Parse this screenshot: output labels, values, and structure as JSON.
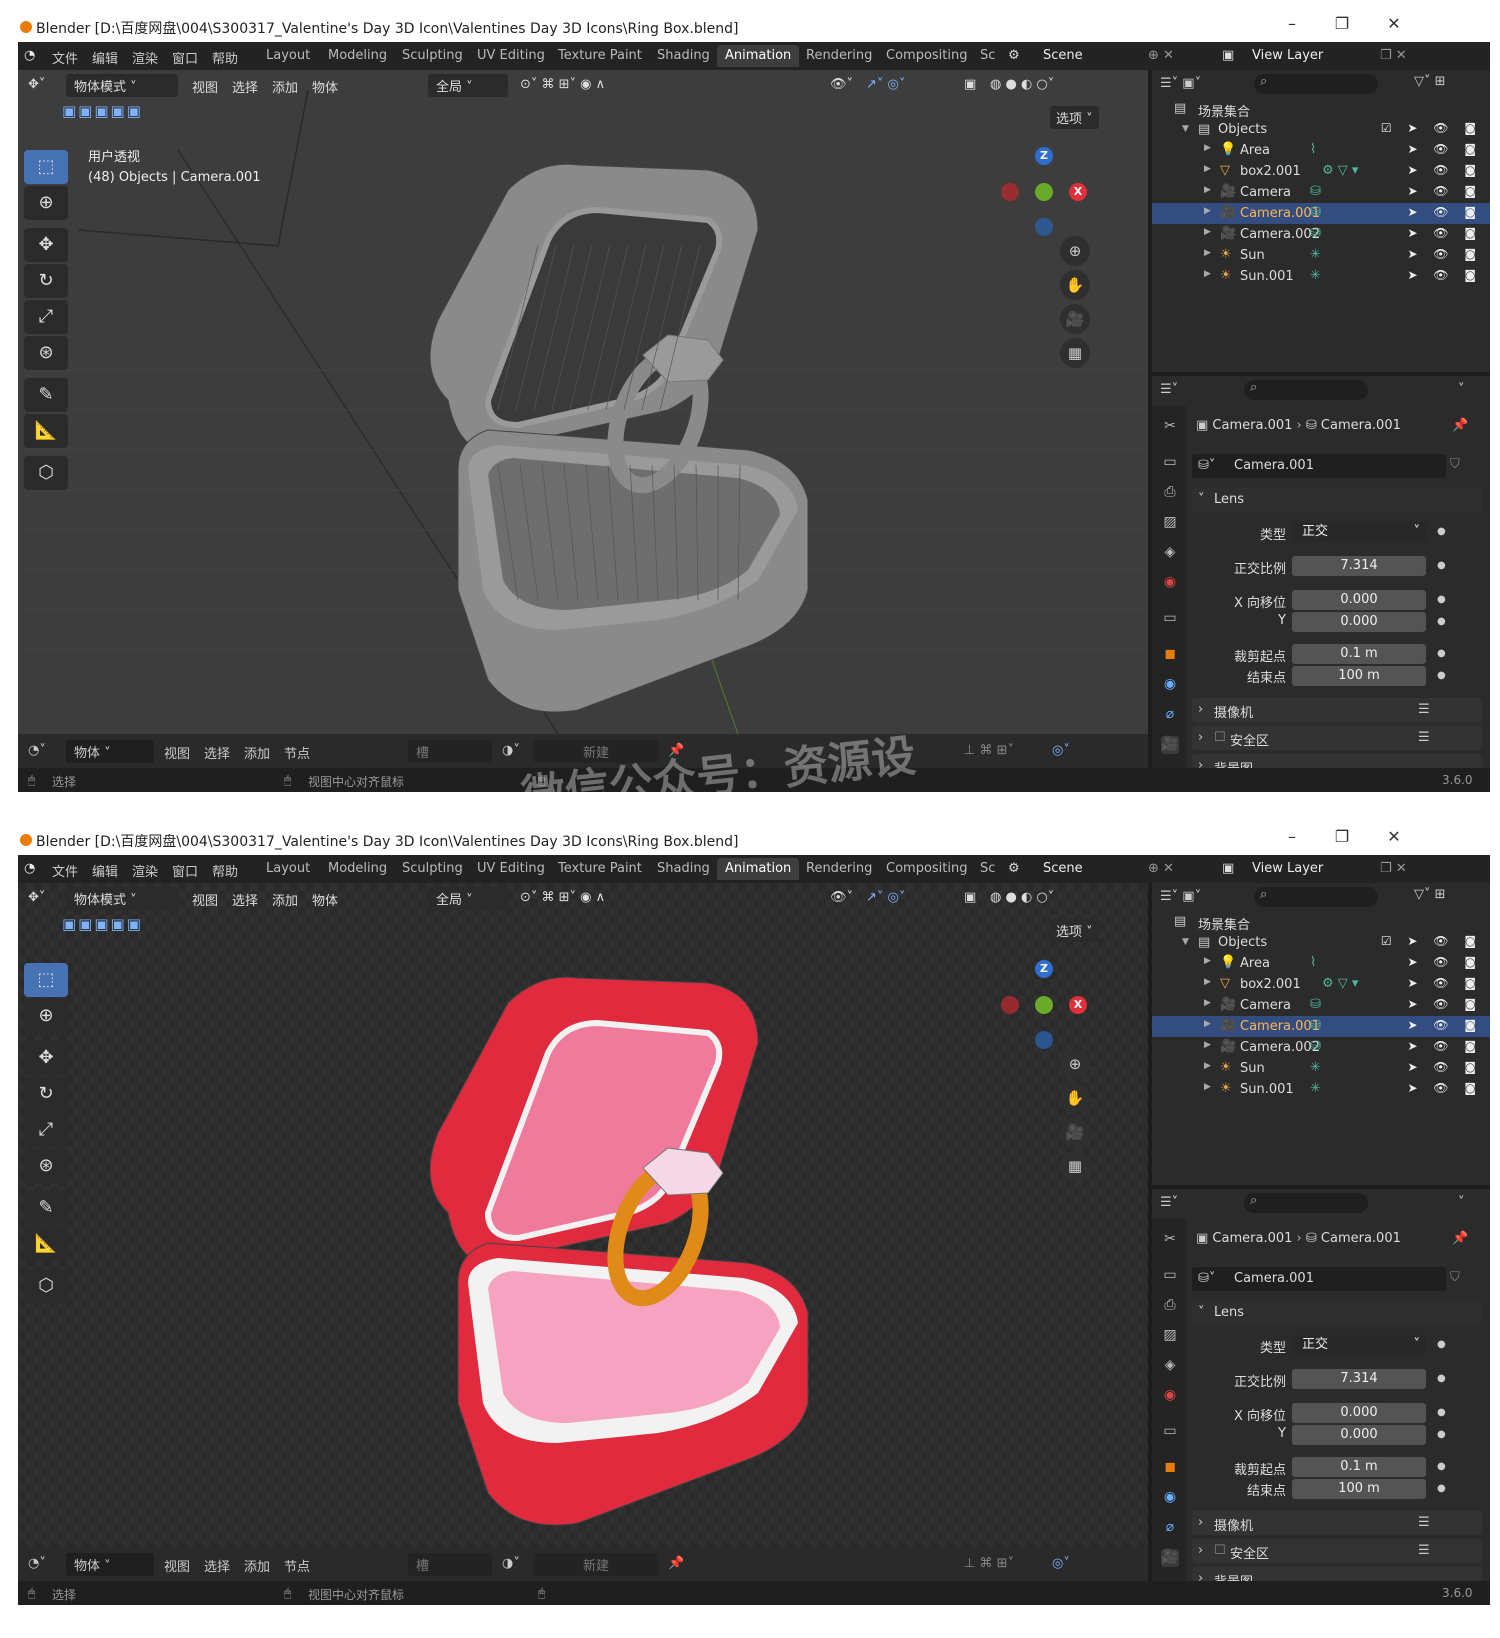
{
  "window_title": "Blender [D:\\百度网盘\\004\\S300317_Valentine's Day 3D Icon\\Valentines Day 3D Icons\\Ring Box.blend]",
  "menu": [
    "文件",
    "编辑",
    "渲染",
    "窗口",
    "帮助"
  ],
  "workspaces": [
    "Layout",
    "Modeling",
    "Sculpting",
    "UV Editing",
    "Texture Paint",
    "Shading",
    "Animation",
    "Rendering",
    "Compositing",
    "Sc"
  ],
  "active_workspace": "Animation",
  "scene": "Scene",
  "view_layer": "View Layer",
  "viewport_header": {
    "mode": "物体模式",
    "view": "视图",
    "select": "选择",
    "add": "添加",
    "object": "物体",
    "transform": "全局",
    "options": "选项"
  },
  "overlay": {
    "view_name": "用户透视",
    "info": "(48) Objects | Camera.001"
  },
  "gizmo": {
    "z": "Z",
    "x": "X"
  },
  "timeline": {
    "mode": "物体",
    "view": "视图",
    "select": "选择",
    "add": "添加",
    "node": "节点",
    "slot": "槽",
    "new": "新建"
  },
  "status": {
    "left": "选择",
    "center": "视图中心对齐鼠标",
    "version": "3.6.0"
  },
  "outliner": {
    "collection": "场景集合",
    "objects": "Objects",
    "items": [
      {
        "name": "Area",
        "selected": false
      },
      {
        "name": "box2.001",
        "selected": false
      },
      {
        "name": "Camera",
        "selected": false
      },
      {
        "name": "Camera.001",
        "selected": true
      },
      {
        "name": "Camera.002",
        "selected": false
      },
      {
        "name": "Sun",
        "selected": false
      },
      {
        "name": "Sun.001",
        "selected": false
      }
    ]
  },
  "properties": {
    "breadcrumb_obj": "Camera.001",
    "breadcrumb_data": "Camera.001",
    "datablock": "Camera.001",
    "lens_panel": "Lens",
    "type_label": "类型",
    "type_value": "正交",
    "scale_label": "正交比例",
    "scale_value": "7.314",
    "shiftx_label": "X 向移位",
    "shiftx_value": "0.000",
    "shifty_label": "Y",
    "shifty_value": "0.000",
    "clip_start_label": "裁剪起点",
    "clip_start_value": "0.1 m",
    "clip_end_label": "结束点",
    "clip_end_value": "100 m",
    "camera_panel": "摄像机",
    "safe_panel": "安全区",
    "bg_panel": "背景图"
  },
  "watermark": "微信公众号：资源设",
  "colors": {
    "accent": "#4772b3",
    "selected_row": "#334d80",
    "orange": "#e87d0d",
    "teal": "#4fb89d",
    "box_red": "#e8253d",
    "box_pink": "#f48fb1"
  }
}
